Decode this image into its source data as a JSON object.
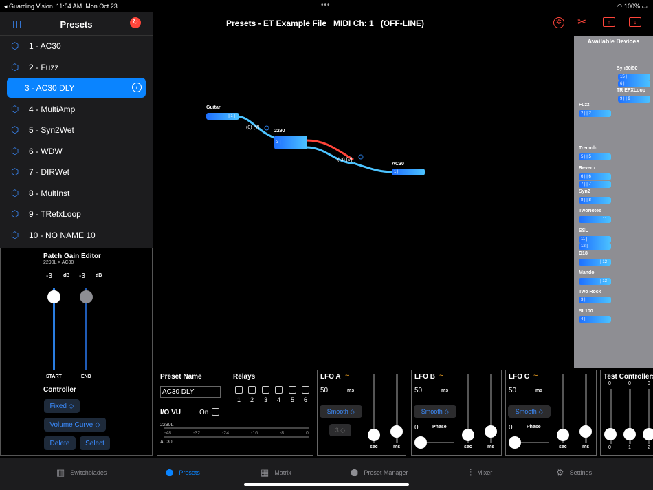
{
  "status_bar": {
    "back_app": "◂ Guarding Vision",
    "time": "11:54 AM",
    "date": "Mon Oct 23",
    "battery": "100%"
  },
  "sidebar": {
    "title": "Presets",
    "items": [
      {
        "label": "1 - AC30"
      },
      {
        "label": "2 - Fuzz"
      },
      {
        "label": "3 - AC30 DLY"
      },
      {
        "label": "4 - MultiAmp"
      },
      {
        "label": "5 - Syn2Wet"
      },
      {
        "label": "6 - WDW"
      },
      {
        "label": "7 - DIRWet"
      },
      {
        "label": "8 - MultInst"
      },
      {
        "label": "9 - TRefxLoop"
      },
      {
        "label": "10 - NO NAME 10"
      }
    ]
  },
  "header": {
    "title": "Presets - ET Example File   MIDI Ch: 1   (OFF-LINE)"
  },
  "gain_editor": {
    "title": "Patch Gain Editor",
    "subtitle": "2290L > AC30",
    "start_value": "-3",
    "end_value": "-3",
    "db_unit": "dB",
    "start_label": "START",
    "end_label": "END",
    "controller_label": "Controller",
    "fixed": "Fixed ◇",
    "curve": "Volume Curve ◇",
    "delete": "Delete",
    "select": "Select"
  },
  "matrix": {
    "guitar": "Guitar",
    "guitar_port": "| 1 |",
    "p2290": "2290",
    "p2290_port": "3 |",
    "ac30": "AC30",
    "ac30_port": "1 |",
    "ann1": "(0) [V]",
    "ann2": "(-3) [V]"
  },
  "available": {
    "title": "Available Devices",
    "devices": [
      {
        "name": "Syn50/50",
        "ports": [
          "15 |",
          "6 |"
        ]
      },
      {
        "name": "TR EFXLoop",
        "ports": [
          "9 |   | 9"
        ]
      },
      {
        "name": "Fuzz",
        "ports": [
          "2 |   | 2"
        ]
      },
      {
        "name": "Tremolo",
        "ports": [
          "5 |   | 5"
        ]
      },
      {
        "name": "Reverb",
        "ports": [
          "6 |   | 6",
          "7 |   | 7"
        ]
      },
      {
        "name": "Syn2",
        "ports": [
          "8 |   | 8"
        ]
      },
      {
        "name": "TwoNotes",
        "ports": [
          "| 11"
        ]
      },
      {
        "name": "SSL",
        "ports": [
          "11 |",
          "12 |"
        ]
      },
      {
        "name": "D18",
        "ports": [
          "| 12"
        ]
      },
      {
        "name": "Mando",
        "ports": [
          "| 13"
        ]
      },
      {
        "name": "Two Rock",
        "ports": [
          "3 |"
        ]
      },
      {
        "name": "SL100",
        "ports": [
          "4 |"
        ]
      }
    ]
  },
  "preset_panel": {
    "name_label": "Preset Name",
    "name_value": "AC30 DLY",
    "relays_label": "Relays",
    "relays": [
      "1",
      "2",
      "3",
      "4",
      "5",
      "6"
    ],
    "io_vu": "I/O VU",
    "on": "On",
    "vu_in": "2290L",
    "vu_out": "AC30",
    "scale": [
      "-48",
      "-32",
      "-24",
      "-16",
      "-8",
      "0"
    ]
  },
  "lfo_a": {
    "title": "LFO A",
    "value": "50",
    "unit": "ms",
    "mode": "Smooth ◇",
    "sub": "3 ◇",
    "sec": "sec",
    "ms": "ms"
  },
  "lfo_b": {
    "title": "LFO B",
    "value": "50",
    "unit": "ms",
    "mode": "Smooth ◇",
    "phase_val": "0",
    "phase": "Phase",
    "sec": "sec",
    "ms": "ms"
  },
  "lfo_c": {
    "title": "LFO C",
    "value": "50",
    "unit": "ms",
    "mode": "Smooth ◇",
    "phase_val": "0",
    "phase": "Phase",
    "sec": "sec",
    "ms": "ms"
  },
  "test_controllers": {
    "title": "Test Controllers",
    "top": [
      "0",
      "0",
      "0"
    ],
    "bottom": [
      "0",
      "1",
      "2"
    ]
  },
  "tabs": [
    {
      "label": "Switchblades"
    },
    {
      "label": "Presets"
    },
    {
      "label": "Matrix"
    },
    {
      "label": "Preset Manager"
    },
    {
      "label": "Mixer"
    },
    {
      "label": "Settings"
    }
  ],
  "colors": {
    "accent": "#0a84ff",
    "red": "#ff453a",
    "cable_blue": "#4cc3ff"
  }
}
